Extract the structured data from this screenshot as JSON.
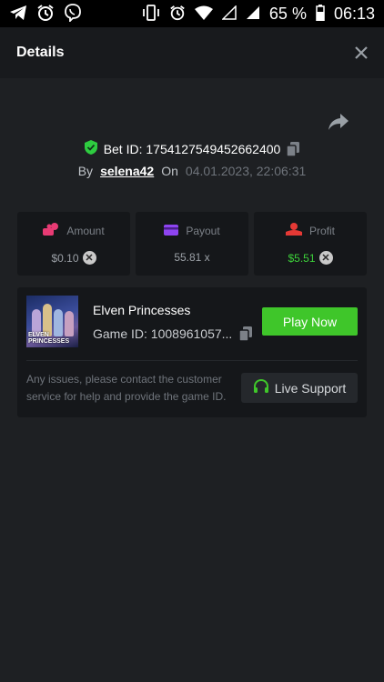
{
  "status_bar": {
    "left_icons": [
      "telegram-icon",
      "alarm-icon",
      "viber-icon"
    ],
    "right_icons": [
      "vibrate-icon",
      "alarm-icon",
      "wifi-icon",
      "signal-icon",
      "signal-icon",
      "battery-icon"
    ],
    "battery": "65 %",
    "time": "06:13"
  },
  "header": {
    "title": "Details",
    "close_icon": "close-icon"
  },
  "share_icon": "share-icon",
  "bet": {
    "id_label": "Bet ID: 1754127549452662400",
    "by_label": "By",
    "username": "selena42",
    "on_label": "On",
    "datetime": "04.01.2023, 22:06:31"
  },
  "stats": [
    {
      "label": "Amount",
      "value": "$0.10",
      "icon": "amount-icon",
      "color": "#e83b74",
      "has_x": true
    },
    {
      "label": "Payout",
      "value": "55.81 x",
      "icon": "card-icon",
      "color": "#8e44f1",
      "has_x": false
    },
    {
      "label": "Profit",
      "value": "$5.51",
      "icon": "profit-icon",
      "color": "#e53935",
      "has_x": true
    }
  ],
  "game": {
    "name": "Elven Princesses",
    "id_label": "Game ID: 1008961057...",
    "thumb_text": "ELVEN PRINCESSES",
    "play_label": "Play Now"
  },
  "support": {
    "text": "Any issues, please contact the customer service for help and provide the game ID.",
    "button_label": "Live Support"
  },
  "colors": {
    "accent_green": "#3fc62a",
    "profit_green": "#3dd23a",
    "shield_green": "#2ecc40",
    "background": "#1e2023",
    "card": "#15171a"
  }
}
